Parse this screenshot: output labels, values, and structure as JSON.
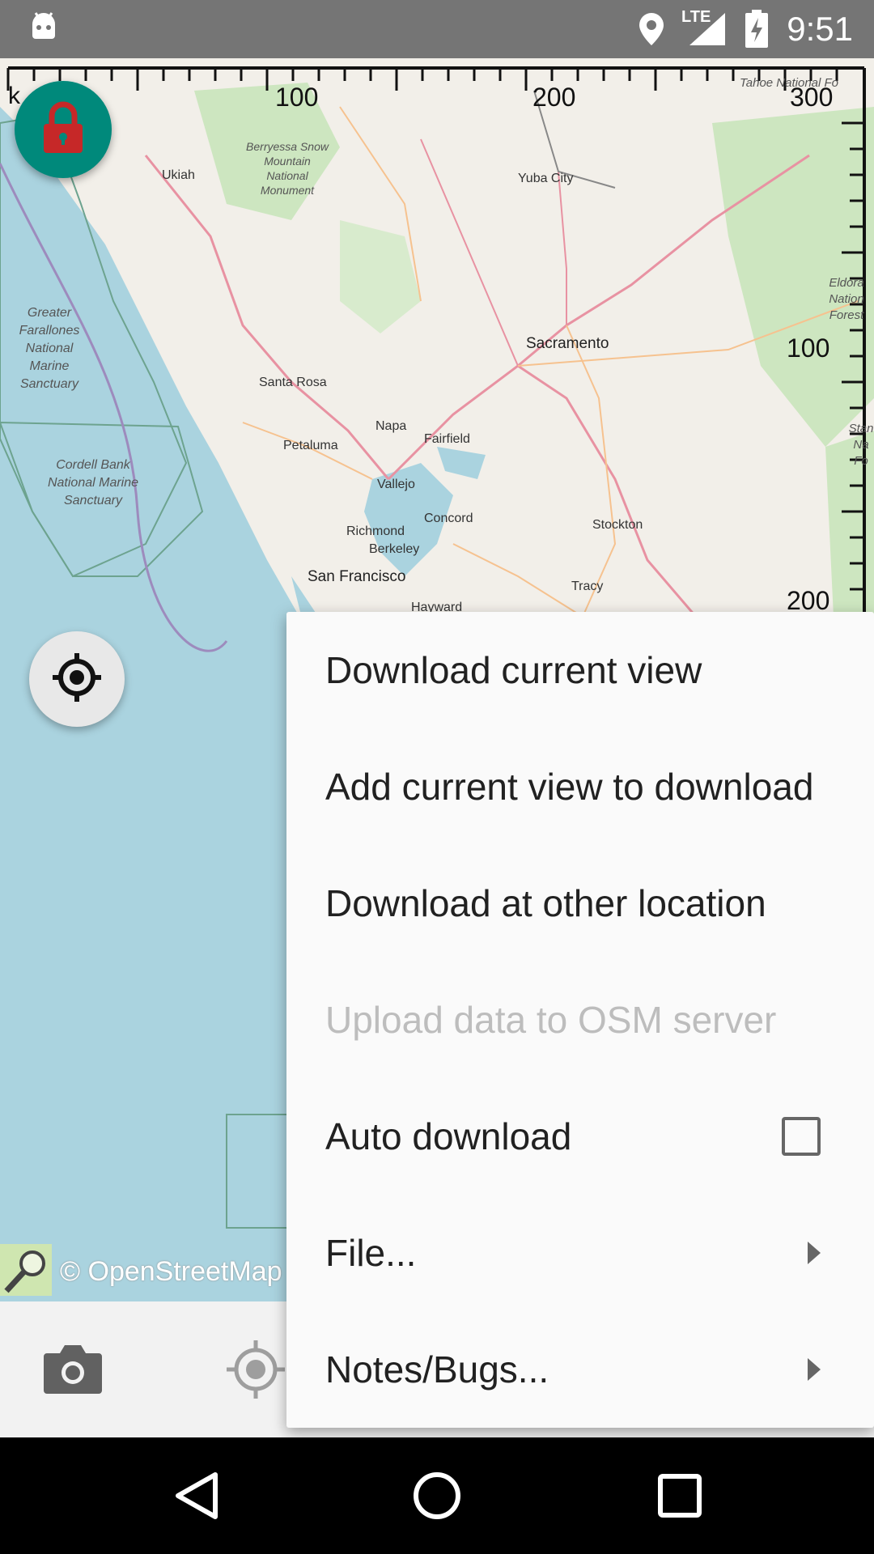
{
  "status_bar": {
    "time": "9:51",
    "network_label": "LTE",
    "icons": [
      "android-debug-icon",
      "location-icon",
      "signal-icon",
      "battery-charging-icon"
    ]
  },
  "map": {
    "scale_labels": [
      "100",
      "200",
      "300",
      "100",
      "200"
    ],
    "scale_prefix": "k",
    "place_labels": {
      "greater_farallones": "Greater Farallones National Marine Sanctuary",
      "cordell_bank": "Cordell Bank National Marine Sanctuary",
      "berryessa": "Berryessa Snow Mountain National Monument",
      "tahoe": "Tahoe National Fo",
      "eldorado": "Eldora Nation Forest",
      "stan": "Stan Na Fo"
    },
    "cities": {
      "ukiah": "Ukiah",
      "yuba_city": "Yuba City",
      "sacramento": "Sacramento",
      "santa_rosa": "Santa Rosa",
      "napa": "Napa",
      "fairfield": "Fairfield",
      "petaluma": "Petaluma",
      "vallejo": "Vallejo",
      "concord": "Concord",
      "richmond": "Richmond",
      "berkeley": "Berkeley",
      "stockton": "Stockton",
      "san_francisco": "San Francisco",
      "tracy": "Tracy",
      "hayward": "Hayward"
    },
    "attribution": "© OpenStreetMap"
  },
  "menu": {
    "items": [
      {
        "label": "Download current view"
      },
      {
        "label": "Add current view to download"
      },
      {
        "label": "Download at other location"
      },
      {
        "label": "Upload data to OSM server"
      },
      {
        "label": "Auto download"
      },
      {
        "label": "File..."
      },
      {
        "label": "Notes/Bugs..."
      }
    ],
    "auto_download_checked": false,
    "disabled_item": "Upload data to OSM server"
  },
  "colors": {
    "status_bar": "#757575",
    "lock_button": "#00897b",
    "lock_icon": "#c62828",
    "water": "#aad3df",
    "land": "#f2efe9"
  }
}
